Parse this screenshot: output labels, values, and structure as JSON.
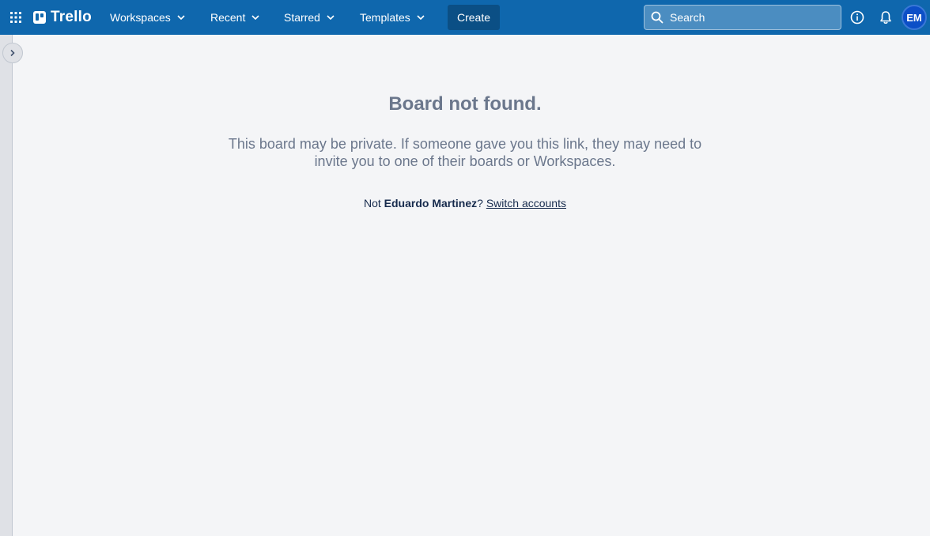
{
  "header": {
    "apps_icon": "grid-icon",
    "logo_text": "Trello",
    "nav": [
      {
        "label": "Workspaces"
      },
      {
        "label": "Recent"
      },
      {
        "label": "Starred"
      },
      {
        "label": "Templates"
      }
    ],
    "create_label": "Create",
    "search": {
      "placeholder": "Search",
      "value": ""
    },
    "info_icon": "info-icon",
    "notifications_icon": "bell-icon",
    "avatar_initials": "EM",
    "colors": {
      "bar": "#0f67ad",
      "create": "#0b4f85",
      "avatar": "#0c4fc7"
    }
  },
  "sidebar": {
    "toggle_icon": "chevron-right-icon"
  },
  "main": {
    "title": "Board not found.",
    "message": "This board may be private. If someone gave you this link, they may need to invite you to one of their boards or Workspaces.",
    "account_prefix": "Not ",
    "account_name": "Eduardo Martinez",
    "account_suffix": "? ",
    "switch_link": "Switch accounts"
  }
}
